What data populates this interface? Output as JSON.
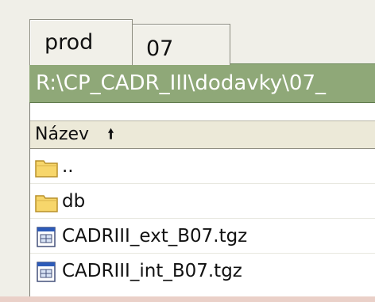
{
  "tabs": [
    {
      "label": "prod"
    },
    {
      "label": "07"
    }
  ],
  "path": "R:\\CP_CADR_III\\dodavky\\07_",
  "list": {
    "column_header": "Název",
    "sort_indicator": "ascending",
    "rows": [
      {
        "name": "..",
        "icon": "folder-up-icon"
      },
      {
        "name": "db",
        "icon": "folder-icon"
      },
      {
        "name": "CADRIII_ext_B07.tgz",
        "icon": "archive-file-icon"
      },
      {
        "name": "CADRIII_int_B07.tgz",
        "icon": "archive-file-icon"
      }
    ]
  },
  "colors": {
    "path_bar": "#8fa878",
    "folder": "#f2c94c",
    "background": "#f0efe8"
  }
}
